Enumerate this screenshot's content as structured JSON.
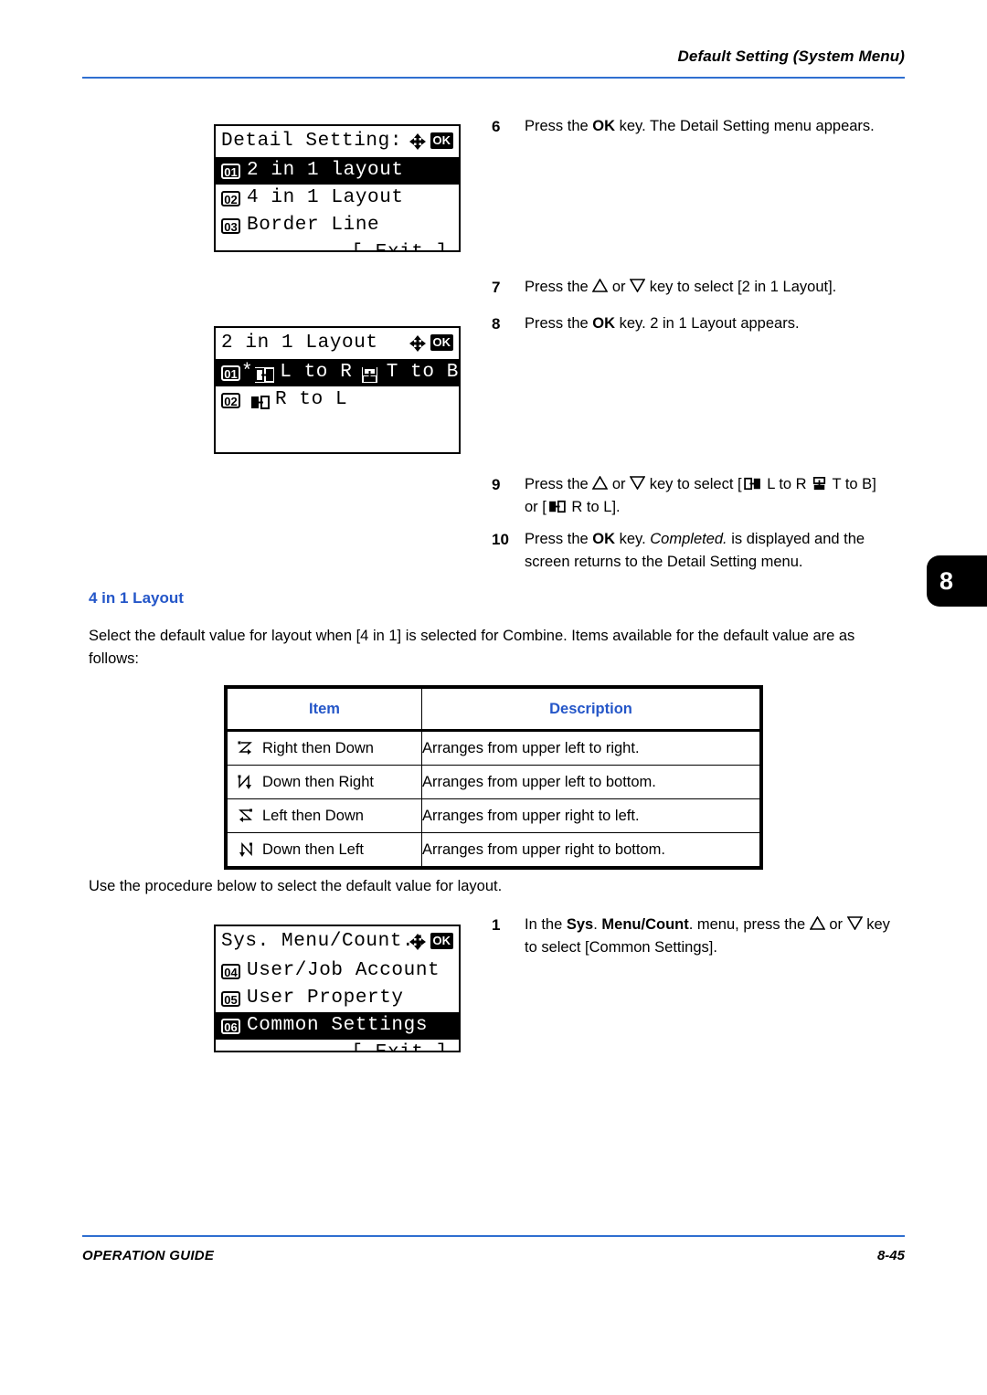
{
  "header": {
    "title": "Default Setting (System Menu)",
    "rule_color": "#2f6fd0"
  },
  "footer": {
    "left": "OPERATION GUIDE",
    "page": "8-45",
    "rule_color": "#2f6fd0"
  },
  "chapter_tab": {
    "number": "8"
  },
  "lcd_panels": [
    {
      "name": "detail-setting",
      "title": "Detail Setting:",
      "icons": [
        "dpad-icon",
        "ok-icon"
      ],
      "rows": [
        {
          "num": "01",
          "label": "2 in 1 layout",
          "selected": true
        },
        {
          "num": "02",
          "label": "4 in 1 Layout",
          "selected": false
        },
        {
          "num": "03",
          "label": "Border Line",
          "selected": false
        }
      ],
      "exit": "[  Exit  ]"
    },
    {
      "name": "two-in-one-layout",
      "title": "2 in 1 Layout",
      "icons": [
        "dpad-icon",
        "ok-icon"
      ],
      "rows": [
        {
          "num": "01",
          "star": "*",
          "label_a": "L to R",
          "label_b": "T to B",
          "selected": true
        },
        {
          "num": "02",
          "star": "",
          "label_a": "R to L",
          "label_b": "",
          "selected": false
        }
      ],
      "exit": ""
    },
    {
      "name": "sys-menu-count",
      "title": "Sys. Menu/Count.:",
      "icons": [
        "dpad-icon",
        "ok-icon"
      ],
      "rows": [
        {
          "num": "04",
          "label": "User/Job Account",
          "selected": false
        },
        {
          "num": "05",
          "label": "User Property",
          "selected": false
        },
        {
          "num": "06",
          "label": "Common Settings",
          "selected": true
        }
      ],
      "exit": "[  Exit  ]"
    }
  ],
  "steps_upper": [
    {
      "num": "6",
      "parts": [
        {
          "t": "Press the "
        },
        {
          "t": "OK",
          "style": "bold"
        },
        {
          "t": " key. The Detail Setting menu appears."
        }
      ]
    },
    {
      "num": "7",
      "parts": [
        {
          "t": "Press the "
        },
        {
          "t": "triangle-up-icon",
          "style": "icon"
        },
        {
          "t": " or "
        },
        {
          "t": "triangle-down-icon",
          "style": "icon"
        },
        {
          "t": " key to select [2 in 1 Layout]."
        }
      ]
    },
    {
      "num": "8",
      "parts": [
        {
          "t": "Press the "
        },
        {
          "t": "OK",
          "style": "bold"
        },
        {
          "t": " key. 2 in 1 Layout appears."
        }
      ]
    },
    {
      "num": "9",
      "parts": [
        {
          "t": "Press the "
        },
        {
          "t": "triangle-up-icon",
          "style": "icon"
        },
        {
          "t": " or "
        },
        {
          "t": "triangle-down-icon",
          "style": "icon"
        },
        {
          "t": " key to select ["
        },
        {
          "t": "layout-lr-icon",
          "style": "icon"
        },
        {
          "t": " L to R "
        },
        {
          "t": "layout-tb-icon",
          "style": "icon"
        },
        {
          "t": " T to B] or ["
        },
        {
          "t": "layout-rl-icon",
          "style": "icon"
        },
        {
          "t": " R to L]."
        }
      ]
    },
    {
      "num": "10",
      "parts": [
        {
          "t": "Press the "
        },
        {
          "t": "OK",
          "style": "bold"
        },
        {
          "t": " key. "
        },
        {
          "t": "Completed.",
          "style": "italic"
        },
        {
          "t": " is displayed and the screen returns to the Detail Setting menu."
        }
      ]
    }
  ],
  "step_texts": {
    "s6_a": "Press the ",
    "s6_ok": "OK",
    "s6_b": " key. The Detail Setting menu appears.",
    "s7_a": "Press the ",
    "s7_mid": " or ",
    "s7_b": " key to select [2 in 1 Layout].",
    "s8_a": "Press the ",
    "s8_ok": "OK",
    "s8_b": " key. 2 in 1 Layout appears.",
    "s9_a": "Press the ",
    "s9_mid": " or ",
    "s9_b": " key to select [",
    "s9_c": " L to R ",
    "s9_d": " T to B] or [",
    "s9_e": " R to L].",
    "s10_a": "Press the ",
    "s10_ok": "OK",
    "s10_b": " key. ",
    "s10_it": "Completed.",
    "s10_c": " is displayed and the screen returns to the Detail Setting menu.",
    "s1_a": "In the ",
    "s1_bold1": "Sys",
    "s1_b": ". ",
    "s1_bold2": "Menu/Count",
    "s1_c": ". menu, press the ",
    "s1_mid": " or ",
    "s1_d": " key to select [Common Settings]."
  },
  "section": {
    "heading": "4 in 1 Layout",
    "heading_color": "#2456c8",
    "intro": "Select the default value for layout when [4 in 1] is selected for Combine. Items available for the default value are as follows:",
    "procedure_lead": "Use the procedure below to select the default value for layout."
  },
  "table": {
    "columns": [
      "Item",
      "Description"
    ],
    "header_color": "#2456c8",
    "rows": [
      {
        "icon": "right-then-down-icon",
        "item": "Right then Down",
        "desc": "Arranges from upper left to right."
      },
      {
        "icon": "down-then-right-icon",
        "item": "Down then Right",
        "desc": "Arranges from upper left to bottom."
      },
      {
        "icon": "left-then-down-icon",
        "item": "Left then Down",
        "desc": "Arranges from upper right to left."
      },
      {
        "icon": "down-then-left-icon",
        "item": "Down then Left",
        "desc": "Arranges from upper right to bottom."
      }
    ]
  },
  "step_one": {
    "num": "1"
  }
}
